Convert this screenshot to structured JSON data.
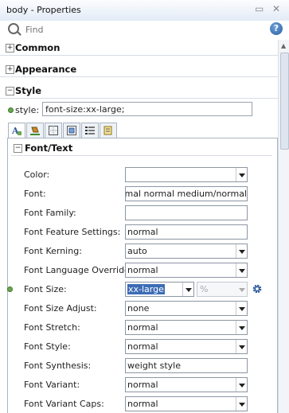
{
  "window": {
    "title": "body - Properties"
  },
  "search": {
    "placeholder": "Find"
  },
  "sections": {
    "common": "Common",
    "appearance": "Appearance",
    "style": "Style"
  },
  "style_field": {
    "label": "style:",
    "value": "font-size:xx-large;"
  },
  "font_text": {
    "title": "Font/Text",
    "rows": [
      {
        "label": "Color:",
        "value": ""
      },
      {
        "label": "Font:",
        "value": "il normal normal medium/normal"
      },
      {
        "label": "Font Family:",
        "value": ""
      },
      {
        "label": "Font Feature Settings:",
        "value": "normal"
      },
      {
        "label": "Font Kerning:",
        "value": "auto"
      },
      {
        "label": "Font Language Override:",
        "value": "normal"
      },
      {
        "label": "Font Size:",
        "value": "xx-large",
        "unit": "%"
      },
      {
        "label": "Font Size Adjust:",
        "value": "none"
      },
      {
        "label": "Font Stretch:",
        "value": "normal"
      },
      {
        "label": "Font Style:",
        "value": "normal"
      },
      {
        "label": "Font Synthesis:",
        "value": "weight style"
      },
      {
        "label": "Font Variant:",
        "value": "normal"
      },
      {
        "label": "Font Variant Caps:",
        "value": "normal"
      }
    ]
  },
  "colors": {
    "accent": "#3d6cb5",
    "set_indicator": "#6aa84f"
  }
}
